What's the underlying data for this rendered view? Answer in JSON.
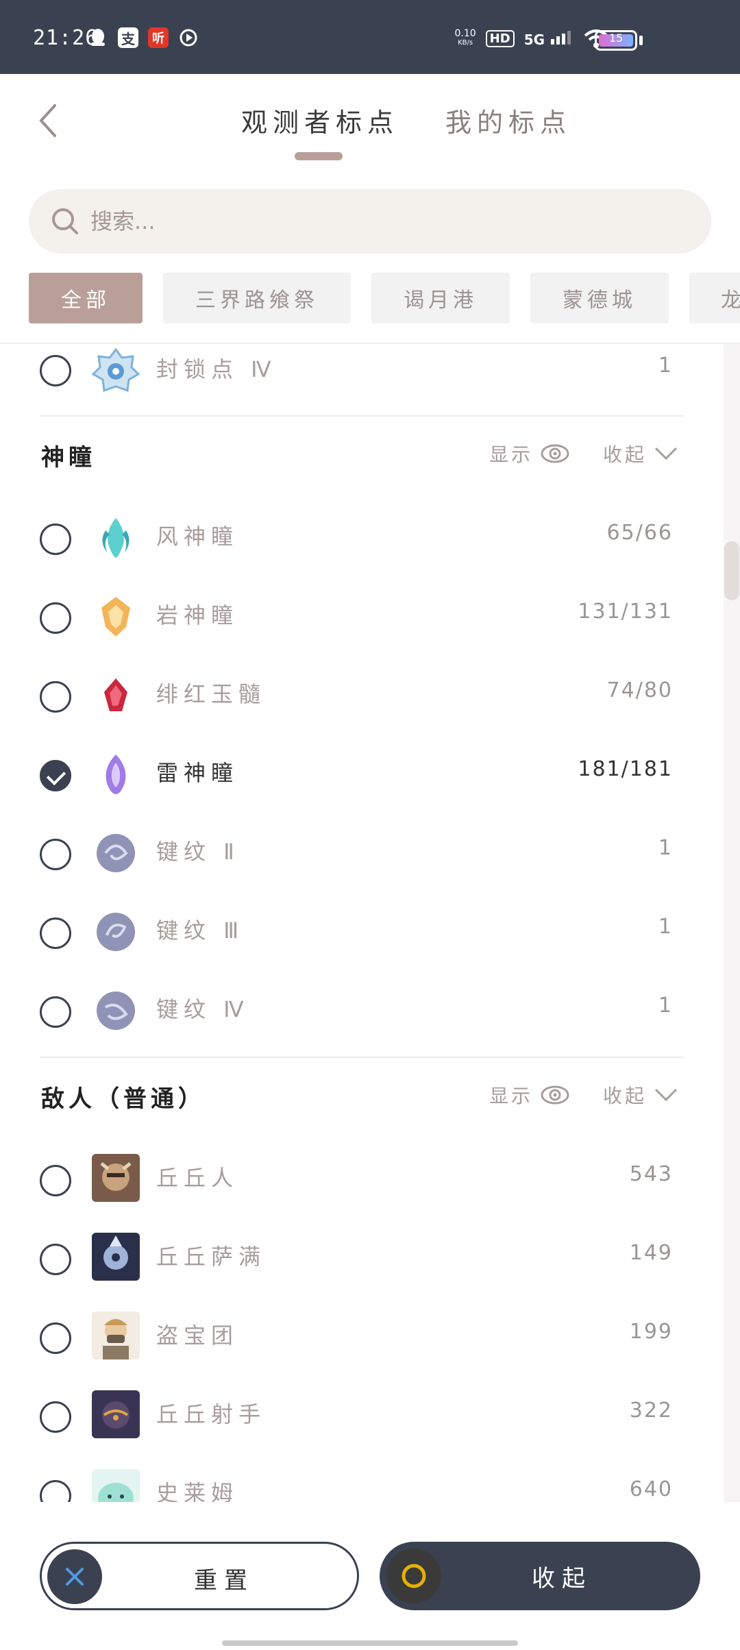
{
  "status_bar": {
    "time": "21:26",
    "net_speed_top": "0.10",
    "net_speed_bottom": "KB/s",
    "hd": "HD",
    "signal": "5G",
    "battery": "15"
  },
  "header": {
    "tabs": [
      {
        "label": "观测者标点",
        "active": true
      },
      {
        "label": "我的标点",
        "active": false
      }
    ]
  },
  "search": {
    "placeholder": "搜索..."
  },
  "filters": [
    "全部",
    "三界路飨祭",
    "谒月港",
    "蒙德城",
    "龙"
  ],
  "groups": [
    {
      "items": [
        {
          "name": "封锁点 Ⅳ",
          "count": "1",
          "checked": false,
          "icon": "seal-icon"
        }
      ]
    },
    {
      "title": "神瞳",
      "show_label": "显示",
      "collapse_label": "收起",
      "items": [
        {
          "name": "风神瞳",
          "count": "65/66",
          "checked": false,
          "icon": "anemoculus-icon"
        },
        {
          "name": "岩神瞳",
          "count": "131/131",
          "checked": false,
          "icon": "geoculus-icon"
        },
        {
          "name": "绯红玉髓",
          "count": "74/80",
          "checked": false,
          "icon": "crimson-agate-icon"
        },
        {
          "name": "雷神瞳",
          "count": "181/181",
          "checked": true,
          "icon": "electroculus-icon"
        },
        {
          "name": "键纹 Ⅱ",
          "count": "1",
          "checked": false,
          "icon": "key-sigil-icon"
        },
        {
          "name": "键纹 Ⅲ",
          "count": "1",
          "checked": false,
          "icon": "key-sigil-icon"
        },
        {
          "name": "键纹 Ⅳ",
          "count": "1",
          "checked": false,
          "icon": "key-sigil-icon"
        }
      ]
    },
    {
      "title": "敌人（普通）",
      "show_label": "显示",
      "collapse_label": "收起",
      "items": [
        {
          "name": "丘丘人",
          "count": "543",
          "checked": false,
          "icon": "hilichurl-icon"
        },
        {
          "name": "丘丘萨满",
          "count": "149",
          "checked": false,
          "icon": "samachurl-icon"
        },
        {
          "name": "盗宝团",
          "count": "199",
          "checked": false,
          "icon": "treasure-hoarder-icon"
        },
        {
          "name": "丘丘射手",
          "count": "322",
          "checked": false,
          "icon": "hilichurl-shooter-icon"
        },
        {
          "name": "史莱姆",
          "count": "640",
          "checked": false,
          "icon": "slime-icon"
        }
      ]
    }
  ],
  "footer": {
    "reset_label": "重置",
    "collapse_label": "收起"
  },
  "colors": {
    "dark": "#3a4150",
    "accent": "#b99f98",
    "muted_text": "#a79d9a"
  }
}
